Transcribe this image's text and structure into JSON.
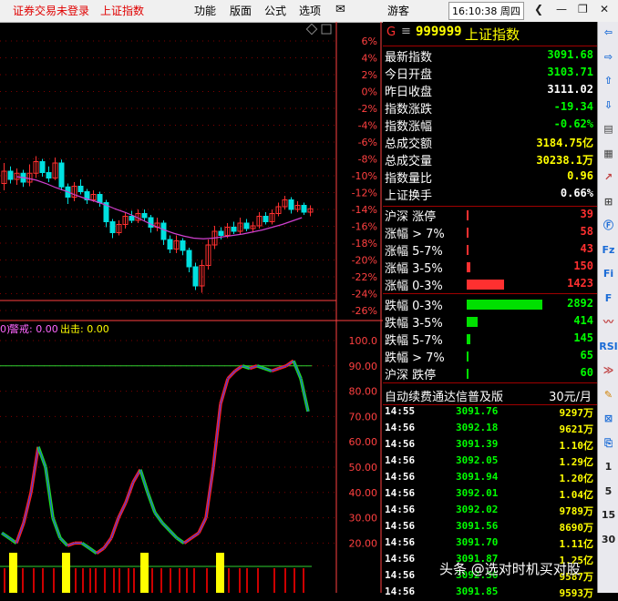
{
  "menubar": {
    "left_status": "证券交易未登录",
    "left_index": "上证指数",
    "items": [
      "功能",
      "版面",
      "公式",
      "选项"
    ],
    "user": "游客",
    "time": "16:10:38 周四"
  },
  "quote": {
    "code": "999999",
    "name": "上证指数",
    "prefix": "G",
    "rows": [
      {
        "label": "最新指数",
        "value": "3091.68",
        "color": "#00ff00"
      },
      {
        "label": "今日开盘",
        "value": "3103.71",
        "color": "#00ff00"
      },
      {
        "label": "昨日收盘",
        "value": "3111.02",
        "color": "#ffffff"
      },
      {
        "label": "指数涨跌",
        "value": "-19.34",
        "color": "#00ff00"
      },
      {
        "label": "指数涨幅",
        "value": "-0.62%",
        "color": "#00ff00"
      },
      {
        "label": "总成交额",
        "value": "3184.75亿",
        "color": "#ffff00"
      },
      {
        "label": "总成交量",
        "value": "30238.1万",
        "color": "#ffff00"
      },
      {
        "label": "指数量比",
        "value": "0.96",
        "color": "#ffff00"
      },
      {
        "label": "上证换手",
        "value": "0.66%",
        "color": "#ffffff"
      }
    ],
    "breadth_up": [
      {
        "label": "沪深 涨停",
        "value": "39",
        "share": 0.004
      },
      {
        "label": "涨幅 > 7%",
        "value": "58",
        "share": 0.006
      },
      {
        "label": "涨幅 5-7%",
        "value": "43",
        "share": 0.005
      },
      {
        "label": "涨幅 3-5%",
        "value": "150",
        "share": 0.016
      },
      {
        "label": "涨幅 0-3%",
        "value": "1423",
        "share": 0.15
      }
    ],
    "breadth_down": [
      {
        "label": "跌幅 0-3%",
        "value": "2892",
        "share": 0.306
      },
      {
        "label": "跌幅 3-5%",
        "value": "414",
        "share": 0.044
      },
      {
        "label": "跌幅 5-7%",
        "value": "145",
        "share": 0.015
      },
      {
        "label": "跌幅 > 7%",
        "value": "65",
        "share": 0.007
      },
      {
        "label": "沪深 跌停",
        "value": "60",
        "share": 0.006
      }
    ],
    "ad_text": "自动续费通达信普及版",
    "ad_price": "30元/月",
    "ticks": [
      {
        "time": "14:55",
        "price": "3091.76",
        "vol": "9297万"
      },
      {
        "time": "14:56",
        "price": "3092.18",
        "vol": "9621万"
      },
      {
        "time": "14:56",
        "price": "3091.39",
        "vol": "1.10亿"
      },
      {
        "time": "14:56",
        "price": "3092.05",
        "vol": "1.29亿"
      },
      {
        "time": "14:56",
        "price": "3091.94",
        "vol": "1.20亿"
      },
      {
        "time": "14:56",
        "price": "3092.01",
        "vol": "1.04亿"
      },
      {
        "time": "14:56",
        "price": "3092.02",
        "vol": "9789万"
      },
      {
        "time": "14:56",
        "price": "3091.56",
        "vol": "8690万"
      },
      {
        "time": "14:56",
        "price": "3091.70",
        "vol": "1.11亿"
      },
      {
        "time": "14:56",
        "price": "3091.87",
        "vol": "1.25亿"
      },
      {
        "time": "14:56",
        "price": "3092.36",
        "vol": "9587万"
      },
      {
        "time": "14:56",
        "price": "3091.85",
        "vol": "9593万"
      }
    ]
  },
  "kline": {
    "pct_ticks": [
      "6%",
      "4%",
      "2%",
      "0%",
      "-2%",
      "-4%",
      "-6%",
      "-8%",
      "-10%",
      "-12%",
      "-14%",
      "-16%",
      "-18%",
      "-20%",
      "-22%",
      "-24%",
      "-26%"
    ],
    "colors": {
      "up": "#ff3030",
      "down": "#00e0e0",
      "ma": "#d040d0",
      "axis": "#ff4040",
      "grid": "#800000"
    },
    "candles": [
      [
        3360,
        3378,
        3390,
        3350
      ],
      [
        3378,
        3366,
        3385,
        3360
      ],
      [
        3366,
        3375,
        3382,
        3358
      ],
      [
        3375,
        3362,
        3380,
        3355
      ],
      [
        3362,
        3375,
        3388,
        3356
      ],
      [
        3375,
        3392,
        3400,
        3368
      ],
      [
        3392,
        3376,
        3396,
        3370
      ],
      [
        3376,
        3368,
        3385,
        3362
      ],
      [
        3368,
        3390,
        3398,
        3365
      ],
      [
        3390,
        3355,
        3395,
        3350
      ],
      [
        3355,
        3340,
        3360,
        3330
      ],
      [
        3340,
        3356,
        3362,
        3334
      ],
      [
        3356,
        3348,
        3366,
        3344
      ],
      [
        3348,
        3336,
        3352,
        3330
      ],
      [
        3336,
        3344,
        3350,
        3333
      ],
      [
        3344,
        3332,
        3348,
        3326
      ],
      [
        3332,
        3304,
        3336,
        3296
      ],
      [
        3304,
        3288,
        3308,
        3280
      ],
      [
        3288,
        3300,
        3306,
        3284
      ],
      [
        3300,
        3312,
        3318,
        3294
      ],
      [
        3312,
        3306,
        3320,
        3302
      ],
      [
        3306,
        3316,
        3322,
        3302
      ],
      [
        3316,
        3310,
        3322,
        3305
      ],
      [
        3310,
        3296,
        3314,
        3288
      ],
      [
        3296,
        3302,
        3310,
        3290
      ],
      [
        3302,
        3278,
        3306,
        3270
      ],
      [
        3278,
        3264,
        3284,
        3258
      ],
      [
        3264,
        3276,
        3284,
        3258
      ],
      [
        3276,
        3262,
        3280,
        3255
      ],
      [
        3262,
        3238,
        3266,
        3230
      ],
      [
        3238,
        3210,
        3244,
        3204
      ],
      [
        3210,
        3240,
        3248,
        3200
      ],
      [
        3240,
        3270,
        3278,
        3234
      ],
      [
        3270,
        3290,
        3298,
        3264
      ],
      [
        3290,
        3284,
        3296,
        3278
      ],
      [
        3284,
        3296,
        3302,
        3280
      ],
      [
        3296,
        3290,
        3304,
        3286
      ],
      [
        3290,
        3302,
        3310,
        3286
      ],
      [
        3302,
        3294,
        3308,
        3290
      ],
      [
        3294,
        3298,
        3304,
        3288
      ],
      [
        3298,
        3312,
        3318,
        3294
      ],
      [
        3312,
        3304,
        3318,
        3300
      ],
      [
        3304,
        3316,
        3322,
        3300
      ],
      [
        3316,
        3326,
        3332,
        3312
      ],
      [
        3326,
        3336,
        3342,
        3322
      ],
      [
        3336,
        3322,
        3340,
        3316
      ],
      [
        3322,
        3328,
        3334,
        3318
      ],
      [
        3328,
        3318,
        3332,
        3314
      ],
      [
        3318,
        3323,
        3328,
        3312
      ]
    ],
    "ma": [
      3370,
      3368,
      3365,
      3360,
      3354,
      3349,
      3343,
      3338,
      3334,
      3329,
      3323,
      3318,
      3312,
      3305,
      3298,
      3292,
      3287,
      3283,
      3280,
      3279,
      3280,
      3282,
      3284,
      3286,
      3289,
      3292,
      3296,
      3300,
      3305,
      3310
    ]
  },
  "indicator": {
    "label_warn": "警戒: 0.00",
    "label_out": "出击: 0.00",
    "prefix": "0)",
    "ticks": [
      "100.0",
      "90.00",
      "80.00",
      "70.00",
      "60.00",
      "50.00",
      "40.00",
      "30.00",
      "20.00"
    ],
    "series": [
      24,
      22,
      20,
      28,
      40,
      58,
      50,
      30,
      22,
      19,
      20,
      20,
      18,
      16,
      18,
      22,
      30,
      36,
      44,
      49,
      40,
      32,
      28,
      25,
      22,
      20,
      22,
      24,
      30,
      50,
      75,
      85,
      88,
      90,
      89,
      90,
      89,
      88,
      89,
      90,
      92,
      85,
      72
    ]
  },
  "watermark": "头条 @选对时机买对股",
  "rtools": [
    "⇦",
    "⇨",
    "⇧",
    "⇩",
    "▤",
    "▦",
    "↗",
    "⊞",
    "Ⓕ",
    "Fz",
    "Fi",
    "F",
    "〰",
    "RSI",
    "≫",
    "✎",
    "⊠",
    "⎘",
    "1",
    "5",
    "15",
    "30"
  ]
}
